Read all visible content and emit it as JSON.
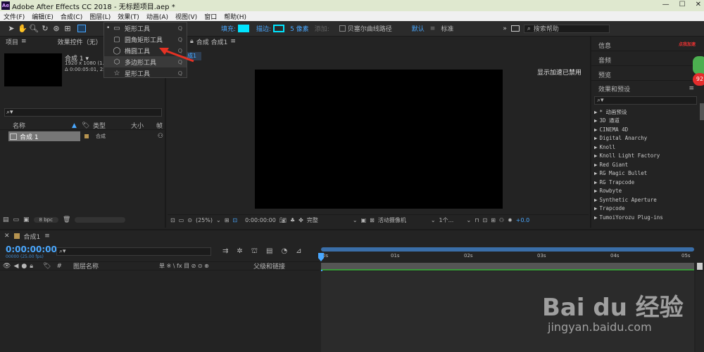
{
  "window": {
    "title": "Adobe After Effects CC 2018 - 无标题项目.aep *",
    "logo": "Ae"
  },
  "menu": [
    "文件(F)",
    "编辑(E)",
    "合成(C)",
    "图层(L)",
    "效果(T)",
    "动画(A)",
    "视图(V)",
    "窗口",
    "帮助(H)"
  ],
  "toolbar": {
    "fill_label": "填充:",
    "stroke_label": "描边:",
    "stroke_size": "5 像素",
    "add_label": "添加:",
    "bezier_label": "贝塞尔曲线路径",
    "workspace_default": "默认",
    "workspace_standard": "标准",
    "search_placeholder": "搜索帮助",
    "fill_color": "#00e5ff",
    "stroke_color": "#00e5ff"
  },
  "shape_menu": {
    "items": [
      {
        "label": "矩形工具",
        "key": "Q",
        "icon": "rectangle-icon"
      },
      {
        "label": "圆角矩形工具",
        "key": "Q",
        "icon": "rounded-rectangle-icon"
      },
      {
        "label": "椭圆工具",
        "key": "Q",
        "icon": "ellipse-icon"
      },
      {
        "label": "多边形工具",
        "key": "Q",
        "icon": "polygon-icon"
      },
      {
        "label": "星形工具",
        "key": "Q",
        "icon": "star-icon"
      }
    ]
  },
  "project": {
    "tab_project": "项目",
    "tab_effects": "效果控件（无）",
    "comp_name": "合成 1 ▾",
    "comp_info1": "1920 x 1080 (1.00)",
    "comp_info2": "Δ 0:00:05:01, 25",
    "col_name": "名称",
    "col_type": "类型",
    "col_size": "大小",
    "col_frame": "帧",
    "rows": [
      {
        "name": "合成 1",
        "type": "合成"
      }
    ],
    "bpc": "8 bpc"
  },
  "composition": {
    "tab": "合成 合成1",
    "sub_tab": "成1",
    "accel_text": "显示加速已禁用",
    "zoom": "(25%)",
    "timecode": "0:00:00:00",
    "quality": "完整",
    "camera": "活动摄像机",
    "views": "1个...",
    "offset": "+0.0"
  },
  "right_panel": {
    "info": "信息",
    "audio": "音频",
    "preview": "预览",
    "effects_presets": "效果和预设",
    "effects": [
      "* 动画预设",
      "3D 通道",
      "CINEMA 4D",
      "Digital Anarchy",
      "Knoll",
      "Knoll Light Factory",
      "Red Giant",
      "RG Magic Bullet",
      "RG Trapcode",
      "Rowbyte",
      "Synthetic Aperture",
      "Trapcode",
      "TumoiYorozu Plug-ins"
    ],
    "badge_text": "点我加速",
    "badge_num": "92"
  },
  "timeline": {
    "tab": "合成1",
    "timecode": "0:00:00:00",
    "frame_info": "00000 (25.00 fps)",
    "col_layer_name": "图层名称",
    "col_switches": "单 ※ \\ fx 目 ⊘ ⊙ ⊕",
    "col_parent": "父级和链接",
    "ticks": [
      "0s",
      "01s",
      "02s",
      "03s",
      "04s",
      "05s"
    ]
  },
  "watermark": {
    "brand": "Bai du 经验",
    "url": "jingyan.baidu.com"
  }
}
